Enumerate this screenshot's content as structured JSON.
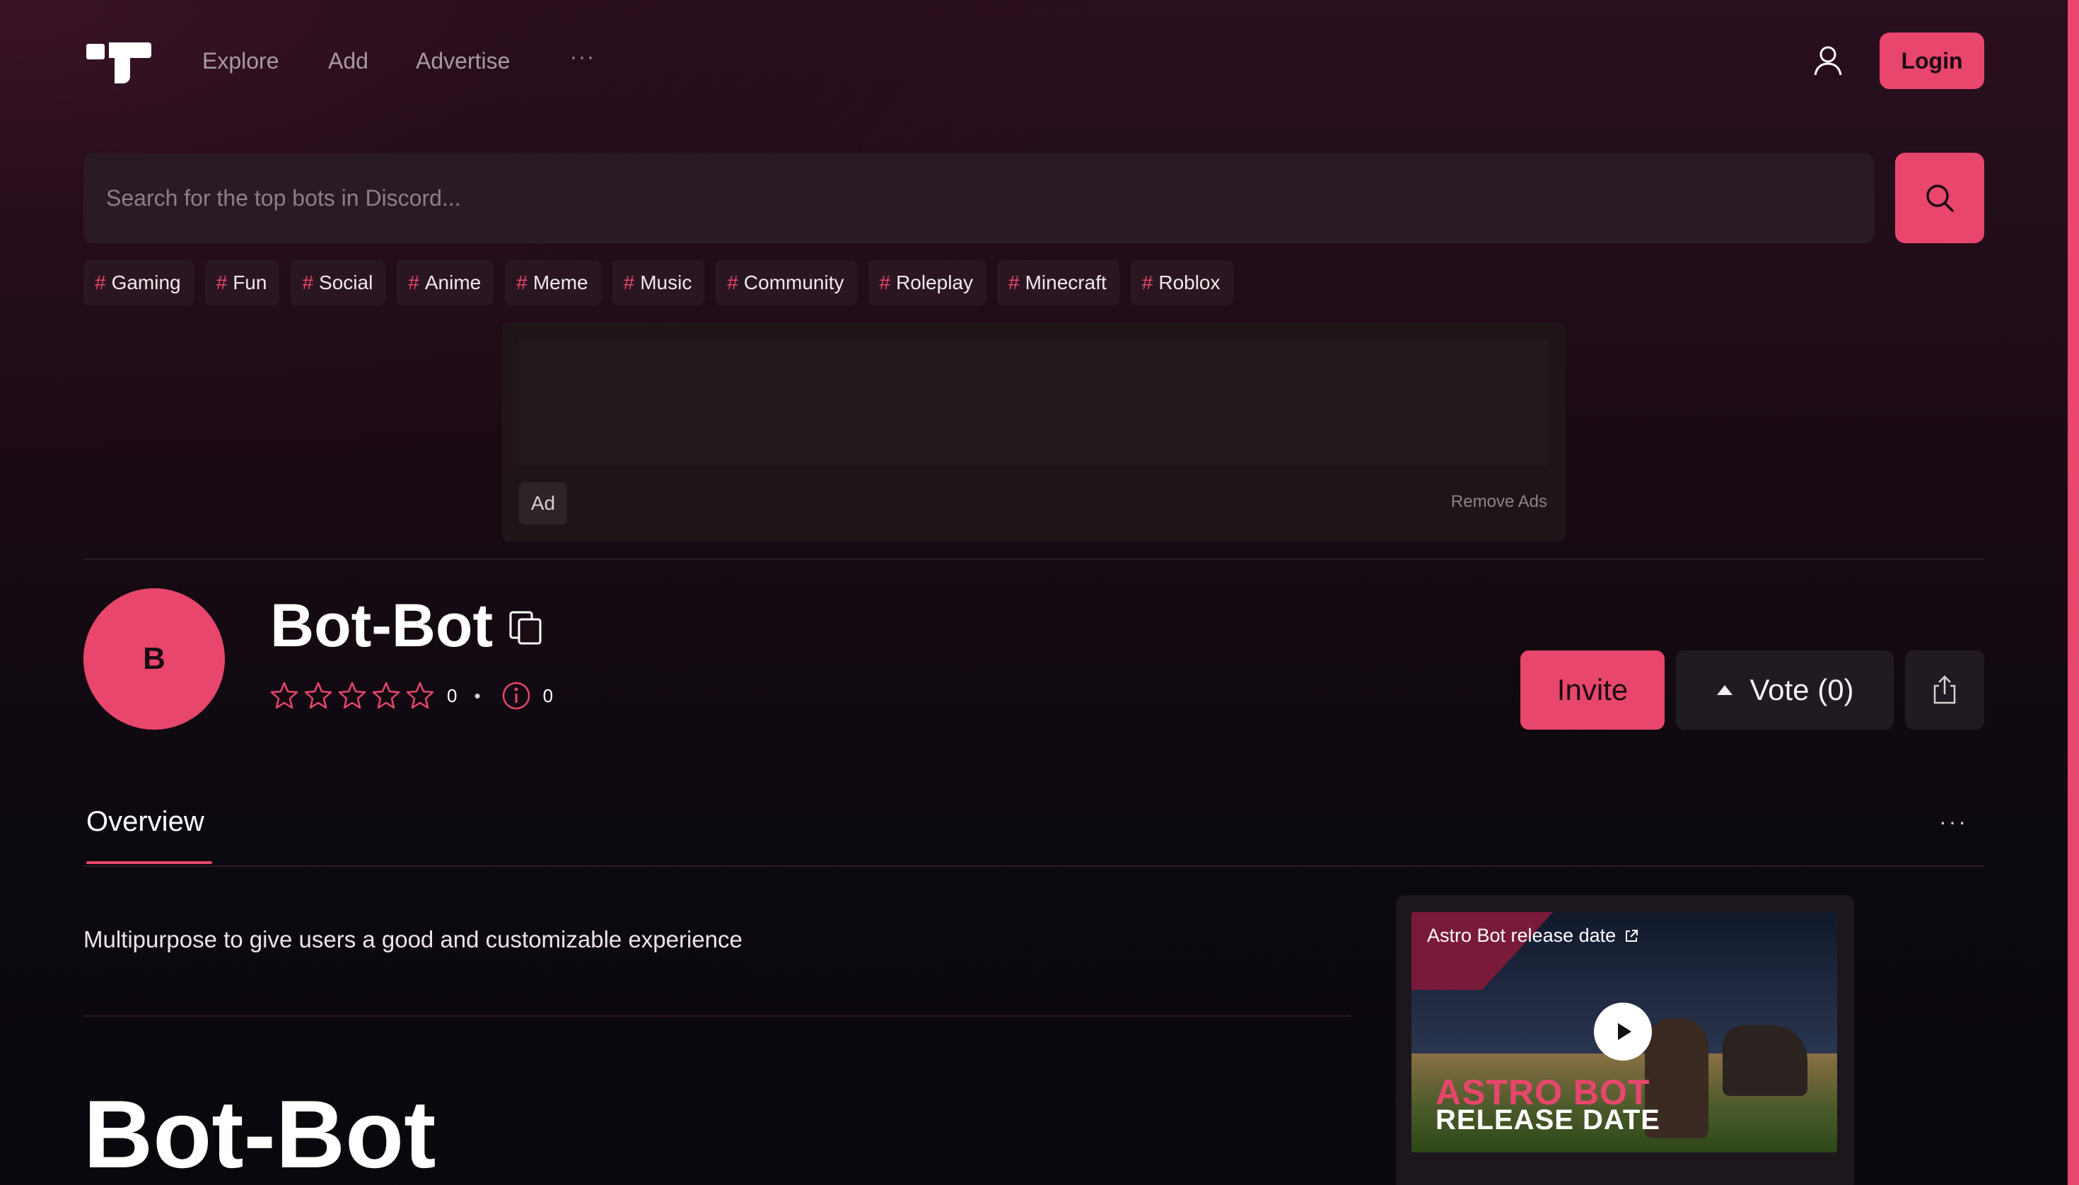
{
  "nav": {
    "links": [
      "Explore",
      "Add",
      "Advertise"
    ],
    "more": "···",
    "login_label": "Login"
  },
  "search": {
    "placeholder": "Search for the top bots in Discord..."
  },
  "tags": [
    "Gaming",
    "Fun",
    "Social",
    "Anime",
    "Meme",
    "Music",
    "Community",
    "Roleplay",
    "Minecraft",
    "Roblox"
  ],
  "tag_symbol": "#",
  "ad": {
    "badge": "Ad",
    "remove_label": "Remove Ads"
  },
  "bot": {
    "avatar_letter": "B",
    "name": "Bot-Bot",
    "rating_stars": 0,
    "rating_count": "0",
    "separator": "•",
    "reports_count": "0"
  },
  "actions": {
    "invite_label": "Invite",
    "vote_label": "Vote (0)"
  },
  "tabs": {
    "overview": "Overview",
    "more": "···"
  },
  "overview": {
    "description": "Multipurpose to give users a good and customizable experience",
    "heading": "Bot-Bot"
  },
  "video": {
    "title": "Astro Bot release date",
    "overlay_line1": "ASTRO BOT",
    "overlay_line2": "RELEASE DATE"
  },
  "colors": {
    "accent": "#e8466c",
    "background": "#0d0910",
    "surface": "#2a1a24"
  }
}
